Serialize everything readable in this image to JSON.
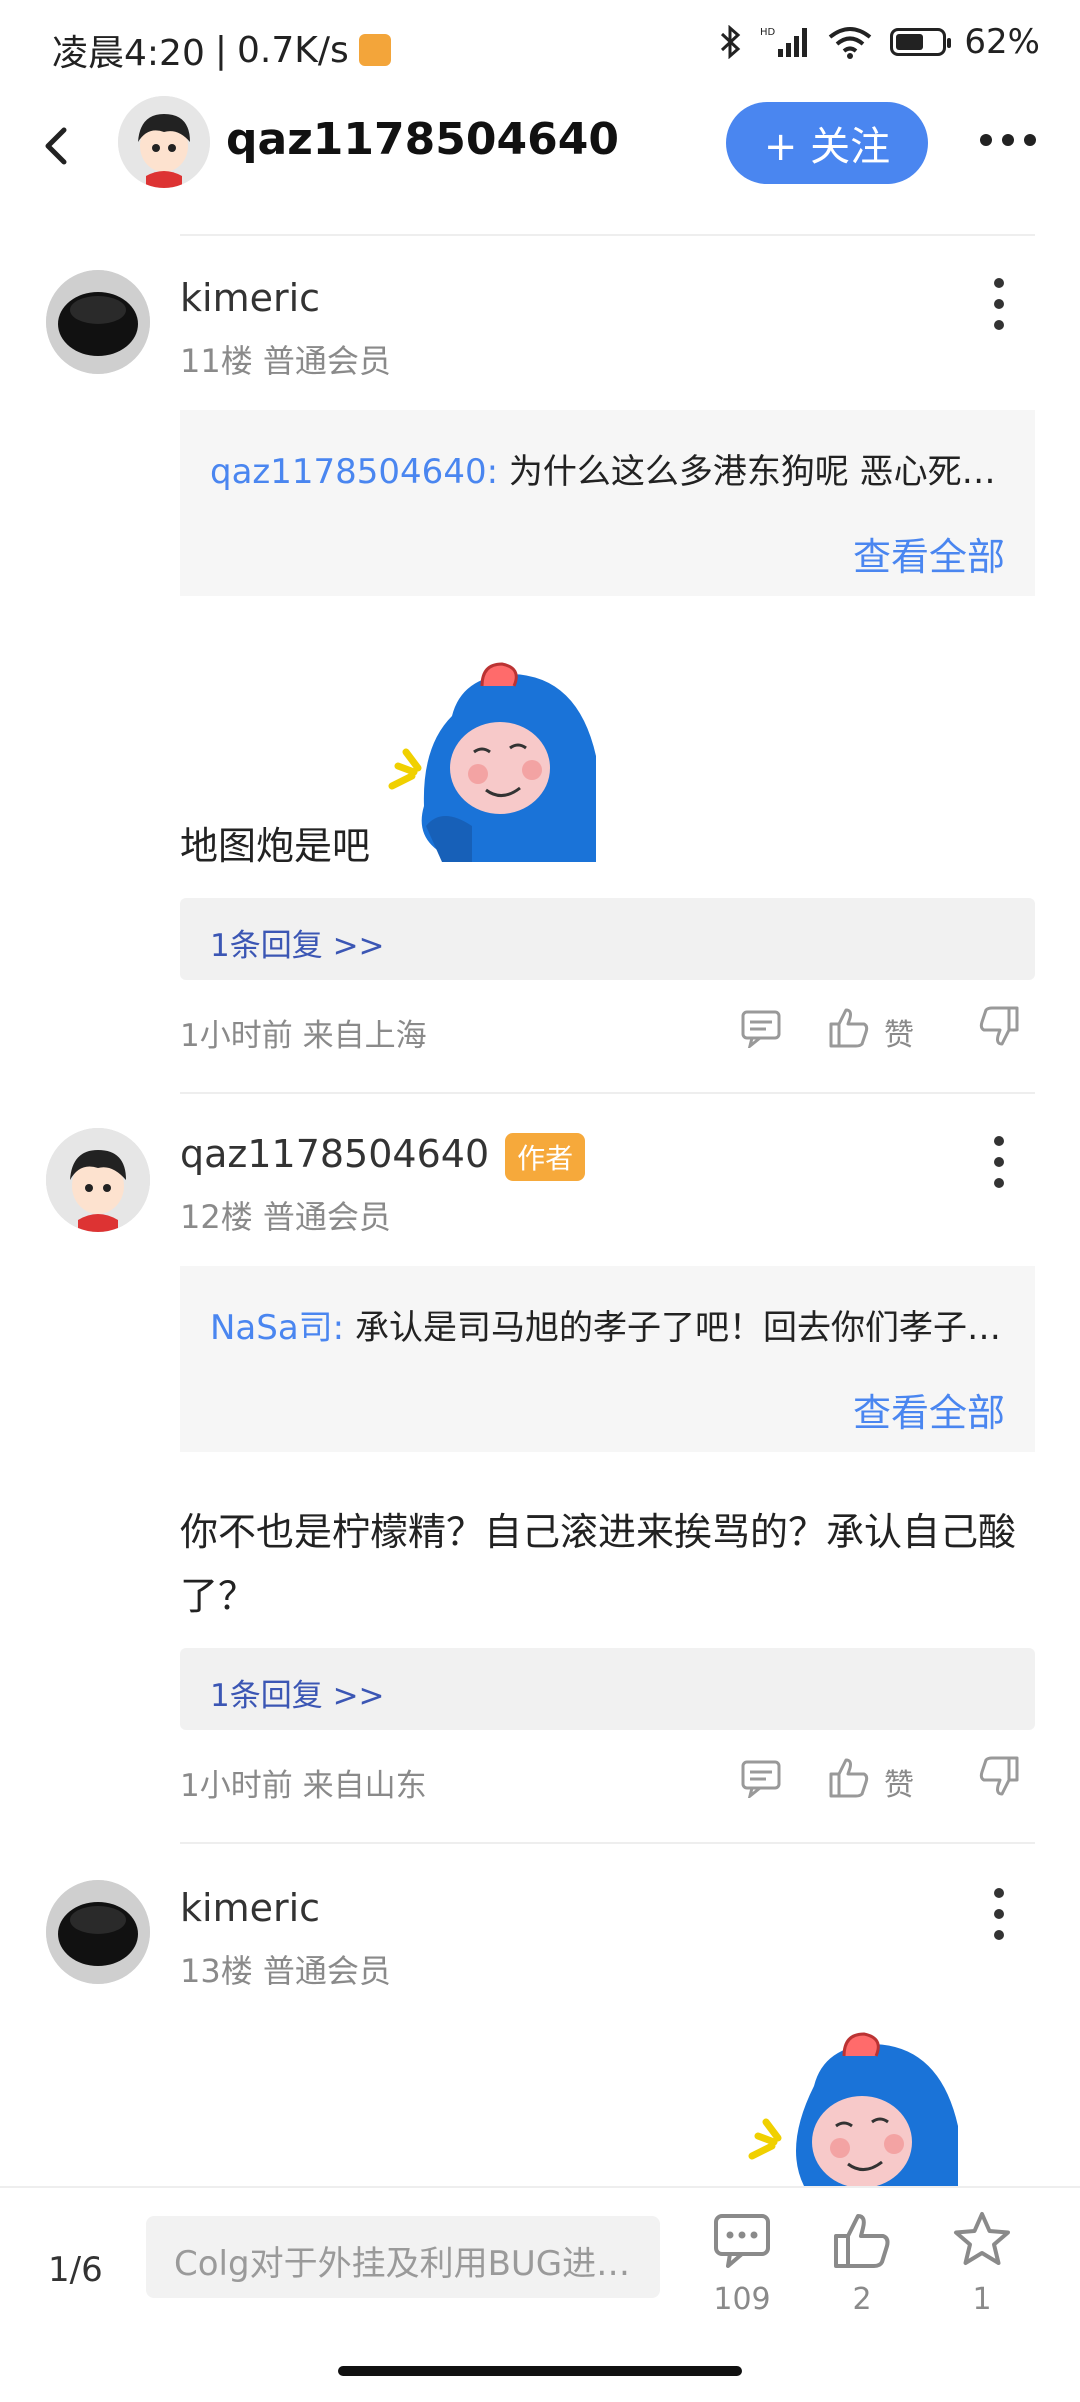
{
  "status_bar": {
    "time": "凌晨4:20",
    "separator": "|",
    "net_speed": "0.7K/s",
    "battery": "62%",
    "signal_label": "HD",
    "icons": [
      "bluetooth-icon",
      "signal-icon",
      "wifi-icon",
      "battery-icon"
    ],
    "battery_level": 0.62
  },
  "header": {
    "username": "qaz1178504640",
    "follow_label": "+ 关注"
  },
  "posts": [
    {
      "username": "kimeric",
      "floor": "11楼",
      "level": "普通会员",
      "quote_user": "qaz1178504640:",
      "quote_text": "为什么这么多港东狗呢 恶心死我了",
      "see_all": "查看全部",
      "text": "地图炮是吧",
      "reply_count_label": "1条回复 >>",
      "time_loc": "1小时前 来自上海",
      "like_label": "赞"
    },
    {
      "username": "qaz1178504640",
      "author_tag": "作者",
      "floor": "12楼",
      "level": "普通会员",
      "quote_user": "NaSa司:",
      "quote_text": "承认是司马旭的孝子了吧！回去你们孝子…",
      "see_all": "查看全部",
      "text": "你不也是柠檬精？自己滚进来挨骂的？承认自己酸了？",
      "reply_count_label": "1条回复 >>",
      "time_loc": "1小时前 来自山东",
      "like_label": "赞"
    },
    {
      "username": "kimeric",
      "floor": "13楼",
      "level": "普通会员"
    }
  ],
  "bottom_bar": {
    "page_indicator": "1/6",
    "input_placeholder": "Colg对于外挂及利用BUG进…",
    "comment_count": "109",
    "like_count": "2",
    "favorite_count": "1"
  },
  "colors": {
    "accent": "#4a86f0",
    "author_tag": "#f6a93b",
    "reply_link": "#3b56b4"
  }
}
